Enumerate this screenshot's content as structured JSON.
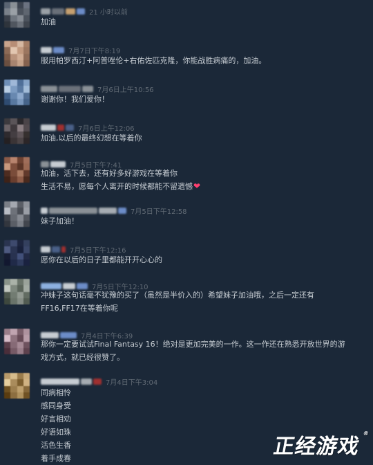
{
  "comments": [
    {
      "time": "21 小时以前",
      "lines": [
        "加油"
      ],
      "avatar_colors": [
        "#5a6472",
        "#8a9096",
        "#3d4450",
        "#6b7280",
        "#7a818a",
        "#9aa0a6",
        "#4b525c",
        "#5f6670",
        "#3a404a",
        "#6e757e",
        "#868c94",
        "#4c535d",
        "#2e343c",
        "#50565f",
        "#6a7079",
        "#3f454e"
      ]
    },
    {
      "time": "7月7日下午8:19",
      "lines": [
        "服用帕罗西汀+阿普唑伦+右佑佐匹克隆，你能战胜病痛的，加油。"
      ],
      "avatar_colors": [
        "#c9a48c",
        "#b88e76",
        "#d6b8a2",
        "#a57e66",
        "#8c6a56",
        "#e2c6b0",
        "#c29a80",
        "#9b7660",
        "#7a5a48",
        "#b9937c",
        "#d0ad95",
        "#8e6b57",
        "#6b4f40",
        "#a78470",
        "#c5a28a",
        "#85624f"
      ]
    },
    {
      "time": "7月6日上午10:56",
      "lines": [
        "谢谢你！我们爱你！"
      ],
      "avatar_colors": [
        "#6e8fb8",
        "#9fb8d8",
        "#4f6f98",
        "#86a4c8",
        "#b8cde4",
        "#7d9cc2",
        "#5a7aa2",
        "#a2bcd8",
        "#3f5f88",
        "#6888b0",
        "#8eaace",
        "#526f94",
        "#2f4c72",
        "#5878a0",
        "#7a98be",
        "#46648a"
      ]
    },
    {
      "time": "7月6日上午12:06",
      "lines": [
        "加油,以后的最终幻想在等着你"
      ],
      "avatar_colors": [
        "#3c3a3e",
        "#5a5458",
        "#2a282c",
        "#4a4448",
        "#6a6266",
        "#3e383c",
        "#8a7e82",
        "#524a4e",
        "#2e2a2e",
        "#443e42",
        "#5e5458",
        "#36302f",
        "#242022",
        "#3a3436",
        "#4c4446",
        "#2c2628"
      ]
    },
    {
      "time": "7月5日下午7:41",
      "lines": [
        "加油，活下去，还有好多好游戏在等着你",
        "生活不易，愿每个人离开的时候都能不留遗憾"
      ],
      "heart": "❤",
      "avatar_colors": [
        "#8a5a48",
        "#b8846e",
        "#6e4232",
        "#a06e5a",
        "#c8987e",
        "#7e4e3c",
        "#5a3426",
        "#9a6852",
        "#4e2c20",
        "#7a4c3a",
        "#aa7a62",
        "#623a2c",
        "#3e2218",
        "#6a3e2e",
        "#8e5c48",
        "#4a2a1e"
      ]
    },
    {
      "time": "7月5日下午12:58",
      "lines": [
        "妹子加油！"
      ],
      "avatar_colors": [
        "#7a7e86",
        "#a4a8b0",
        "#5a5e66",
        "#8e929a",
        "#b8bcc4",
        "#6e727a",
        "#4a4e56",
        "#9a9ea6",
        "#3e424a",
        "#666a72",
        "#868a92",
        "#52565e",
        "#32363e",
        "#5a5e66",
        "#7a7e86",
        "#42464e"
      ]
    },
    {
      "time": "7月5日下午12:16",
      "lines": [
        "愿你在以后的日子里都能开开心心的"
      ],
      "avatar_colors": [
        "#2a3450",
        "#3e4a6e",
        "#1e2640",
        "#34405e",
        "#4e5a80",
        "#2a3452",
        "#18203a",
        "#3a4668",
        "#161c32",
        "#283250",
        "#42507a",
        "#222a46",
        "#121830",
        "#202a48",
        "#2e3a5c",
        "#1a2240"
      ]
    },
    {
      "time": "7月5日下午12:10",
      "lines": [
        "冲妹子这句话毫不犹豫的买了（虽然是半价入的）希望妹子加油哦，之后一定还有",
        "FF16,FF17在等着你呢"
      ],
      "avatar_colors": [
        "#8a948a",
        "#aab2a8",
        "#6a746a",
        "#9aa29a",
        "#c2c8c0",
        "#7e887e",
        "#5a645a",
        "#a2aaa2",
        "#4e584e",
        "#727c72",
        "#929a92",
        "#626c62",
        "#3e483e",
        "#6a746a",
        "#868e86",
        "#525c52"
      ]
    },
    {
      "time": "7月4日下午6:39",
      "lines": [
        "那你一定要试试Final Fantasy 16！绝对是更加完美的一作。这一作还在熟悉开放世界的游",
        "戏方式，就已经很赞了。"
      ],
      "avatar_colors": [
        "#9a7e8a",
        "#c0a4b0",
        "#7a5e6a",
        "#ae929e",
        "#d6bcc8",
        "#8e727e",
        "#664a56",
        "#b89ca8",
        "#5a3e4a",
        "#866a76",
        "#a68a96",
        "#6e525e",
        "#4a2e3a",
        "#765a66",
        "#9a7e8a",
        "#5e424e"
      ]
    },
    {
      "time": "7月4日下午3:04",
      "lines": [
        "同病相怜",
        "感同身受",
        "好言相劝",
        "好语如珠",
        "活色生香",
        "着手成春"
      ],
      "avatar_colors": [
        "#b89a6a",
        "#d6bc8c",
        "#9a7c4c",
        "#c8aa7a",
        "#e6ce9e",
        "#aa8c5c",
        "#7c5e2e",
        "#d0b282",
        "#6e5020",
        "#9c7e4e",
        "#be a06e",
        "#86683a",
        "#5a3c10",
        "#8c6e40",
        "#b0925e",
        "#705224"
      ]
    }
  ],
  "watermark": {
    "text": "正经游戏",
    "mark": "®"
  }
}
